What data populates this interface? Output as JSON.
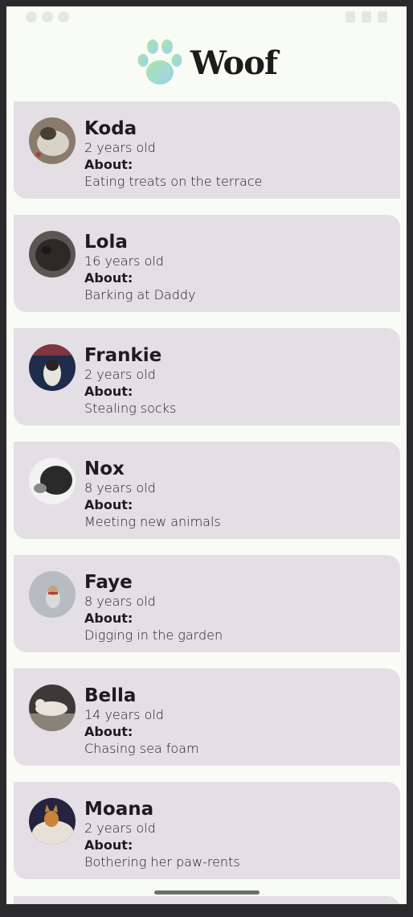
{
  "app": {
    "title": "Woof",
    "logo_icon": "paw-icon"
  },
  "dogs": [
    {
      "name": "Koda",
      "age": "2 years old",
      "about_label": "About:",
      "about": "Eating treats on the terrace",
      "avatar_colors": [
        "#8a7a6a",
        "#d8d2c8",
        "#4a3f36"
      ]
    },
    {
      "name": "Lola",
      "age": "16 years old",
      "about_label": "About:",
      "about": "Barking at Daddy",
      "avatar_colors": [
        "#2c2a28",
        "#5a5652",
        "#1a1918"
      ]
    },
    {
      "name": "Frankie",
      "age": "2 years old",
      "about_label": "About:",
      "about": "Stealing socks",
      "avatar_colors": [
        "#1f2d4a",
        "#c23a3a",
        "#e8e4de"
      ]
    },
    {
      "name": "Nox",
      "age": "8 years old",
      "about_label": "About:",
      "about": "Meeting new animals",
      "avatar_colors": [
        "#f2f2f2",
        "#2a2a2a",
        "#8a8a8a"
      ]
    },
    {
      "name": "Faye",
      "age": "8 years old",
      "about_label": "About:",
      "about": "Digging in the garden",
      "avatar_colors": [
        "#b7bcc0",
        "#d8dadc",
        "#b04030"
      ]
    },
    {
      "name": "Bella",
      "age": "14 years old",
      "about_label": "About:",
      "about": "Chasing sea foam",
      "avatar_colors": [
        "#3b3a36",
        "#e8e4dc",
        "#8a8478"
      ]
    },
    {
      "name": "Moana",
      "age": "2 years old",
      "about_label": "About:",
      "about": "Bothering her paw-rents",
      "avatar_colors": [
        "#26233f",
        "#c9853a",
        "#e6e0d6"
      ]
    }
  ],
  "colors": {
    "background": "#f8fcf5",
    "card": "#e3dfe5",
    "text": "#1c1b1f",
    "logo_gradient_start": "#a8e6a8",
    "logo_gradient_end": "#9ed0f0"
  }
}
